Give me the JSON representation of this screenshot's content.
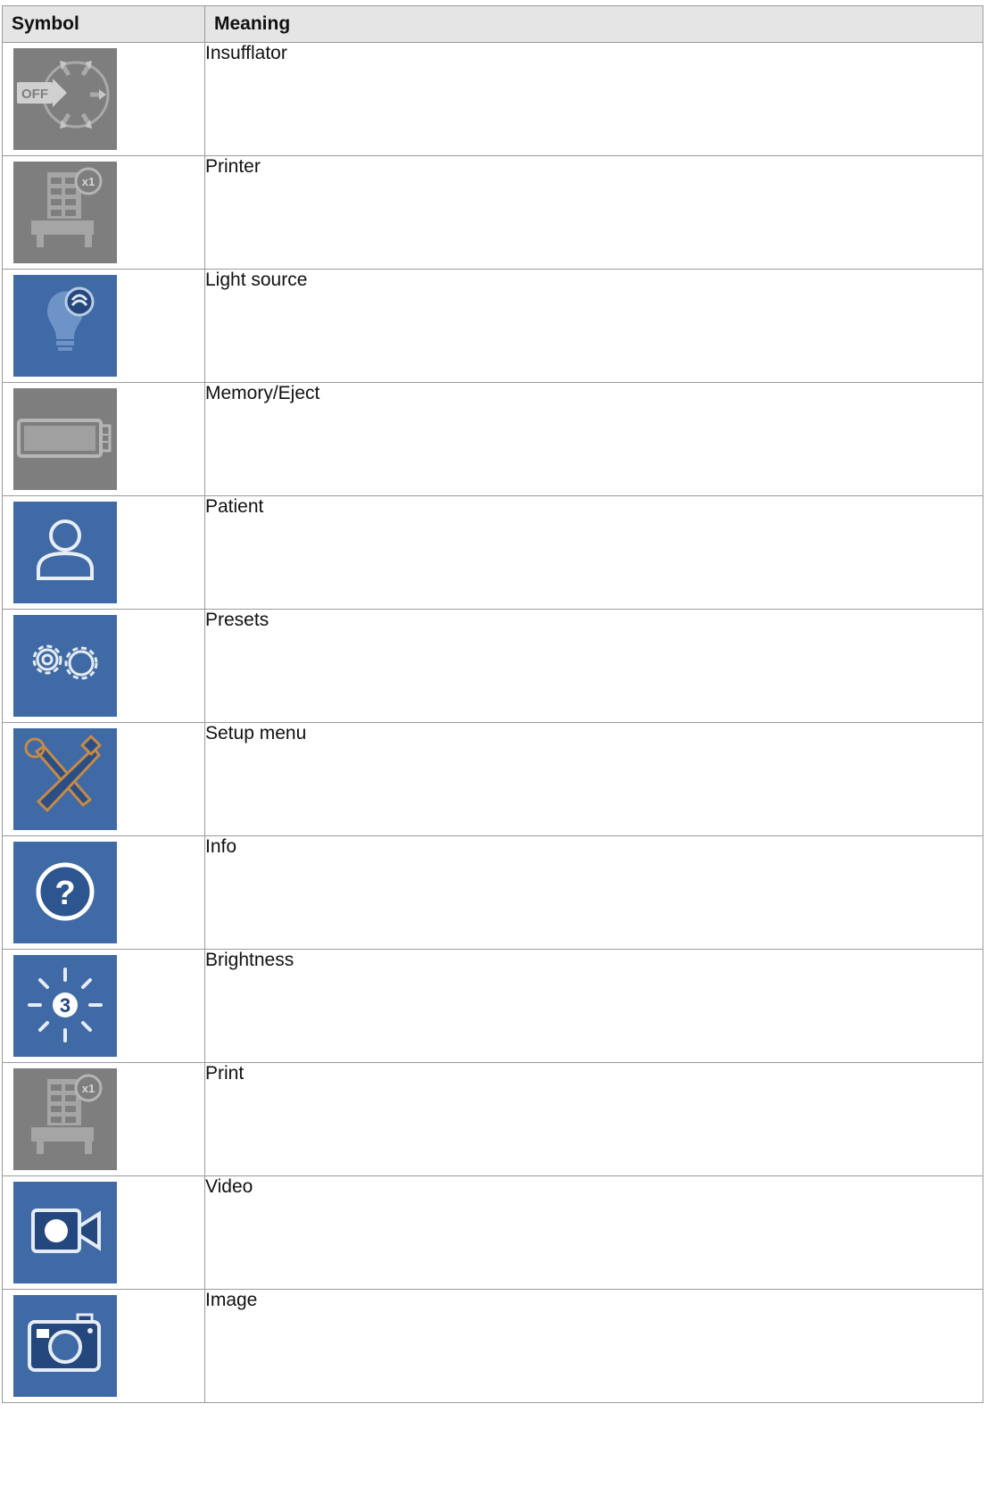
{
  "table": {
    "headers": {
      "symbol": "Symbol",
      "meaning": "Meaning"
    },
    "rows": [
      {
        "icon": "insufflator-icon",
        "meaning": "Insufflator",
        "badge": "OFF",
        "tile_color": "#7e7e7e"
      },
      {
        "icon": "printer-icon",
        "meaning": "Printer",
        "badge": "x1",
        "tile_color": "#7e7e7e"
      },
      {
        "icon": "light-source-icon",
        "meaning": "Light source",
        "tile_color": "#3f6aa6"
      },
      {
        "icon": "memory-eject-icon",
        "meaning": "Memory/Eject",
        "tile_color": "#7e7e7e"
      },
      {
        "icon": "patient-icon",
        "meaning": "Patient",
        "tile_color": "#3f6aa6"
      },
      {
        "icon": "presets-icon",
        "meaning": "Presets",
        "tile_color": "#3f6aa6"
      },
      {
        "icon": "setup-menu-icon",
        "meaning": "Setup menu",
        "tile_color": "#3f6aa6"
      },
      {
        "icon": "info-icon",
        "meaning": "Info",
        "badge": "?",
        "tile_color": "#3f6aa6"
      },
      {
        "icon": "brightness-icon",
        "meaning": "Brightness",
        "badge": "3",
        "tile_color": "#3f6aa6"
      },
      {
        "icon": "print-icon",
        "meaning": "Print",
        "badge": "x1",
        "tile_color": "#7e7e7e"
      },
      {
        "icon": "video-icon",
        "meaning": "Video",
        "tile_color": "#3f6aa6"
      },
      {
        "icon": "image-icon",
        "meaning": "Image",
        "tile_color": "#3f6aa6"
      }
    ]
  }
}
